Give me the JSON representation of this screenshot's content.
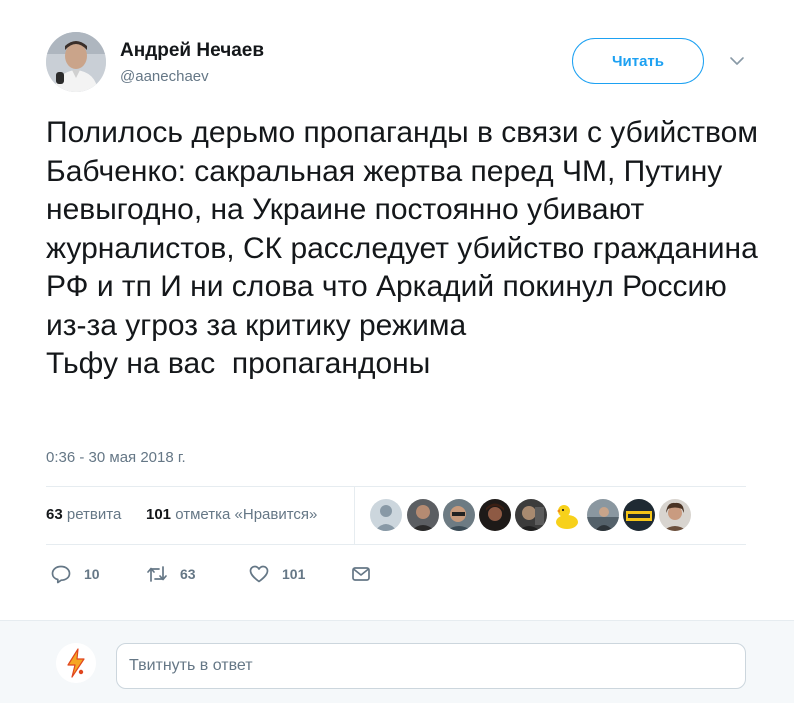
{
  "author": {
    "name": "Андрей Нечаев",
    "handle": "@aanechaev"
  },
  "follow_label": "Читать",
  "tweet": {
    "text": "Полилось дерьмо пропаганды в связи с убийством Бабченко: сакральная жертва перед ЧМ, Путину невыгодно, на Украине постоянно убивают журналистов, СК расследует убийство гражданина РФ и тп И ни слова что Аркадий покинул Россию из-за угроз за критику режима\nТьфу на вас  пропагандоны",
    "timestamp": "0:36 - 30 мая 2018 г."
  },
  "stats": {
    "retweets_count": "63",
    "retweets_label": "ретвита",
    "likes_count": "101",
    "likes_label": "отметка «Нравится»"
  },
  "actions": {
    "reply_count": "10",
    "retweet_count": "63",
    "like_count": "101"
  },
  "reply": {
    "placeholder": "Твитнуть в ответ"
  },
  "colors": {
    "accent": "#1da1f2",
    "secondary_text": "#657786",
    "primary_text": "#14171a",
    "divider": "#e6ecf0"
  },
  "icons": [
    "caret-down-icon",
    "reply-icon",
    "retweet-icon",
    "like-icon",
    "message-icon"
  ]
}
